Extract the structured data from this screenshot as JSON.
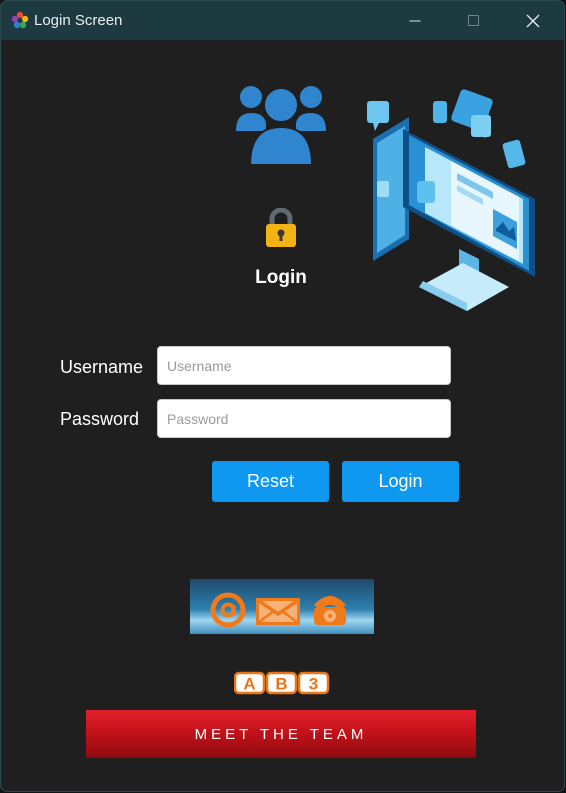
{
  "window": {
    "title": "Login Screen",
    "controls": [
      "minimize-icon",
      "maximize-icon",
      "close-icon"
    ]
  },
  "login": {
    "heading": "Login",
    "username_label": "Username",
    "username_placeholder": "Username",
    "username_value": "",
    "password_label": "Password",
    "password_placeholder": "Password",
    "password_value": "",
    "reset_label": "Reset",
    "login_label": "Login"
  },
  "footer": {
    "contact_banner_icons": [
      "at-sign-icon",
      "envelope-icon",
      "telephone-icon"
    ],
    "logo_text": "AB3",
    "meet_label": "MEET THE TEAM"
  },
  "icons": {
    "header": "users-icon",
    "lock": "lock-icon",
    "illustration": "computer-monitor-illustration"
  },
  "colors": {
    "titlebar": "#1c3a3f",
    "background": "#1f1f1f",
    "accent_button": "#0f98f0",
    "meet_button": "#c4121b",
    "lock_body": "#f2b313"
  }
}
